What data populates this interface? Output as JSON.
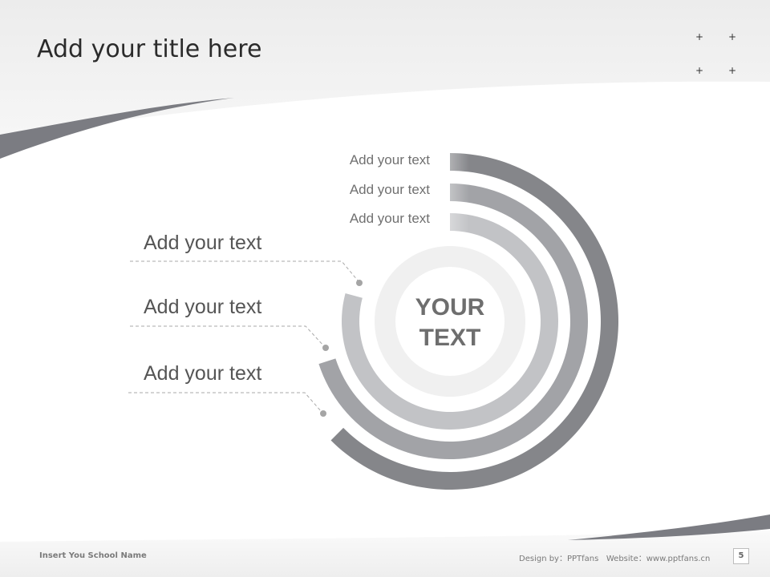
{
  "slide": {
    "title": "Add your title here",
    "decor_marks": [
      "+",
      "+",
      "+",
      "+"
    ],
    "colors": {
      "accent_dark": "#7c7d82",
      "ring_outer": "#85868a",
      "ring_middle": "#a2a3a7",
      "ring_inner": "#c2c3c6",
      "inner_circle": "#f0f0f0",
      "background_band": "#f1f1f1"
    }
  },
  "diagram": {
    "center_text": [
      "YOUR",
      "TEXT"
    ],
    "ring_labels": [
      "Add your text",
      "Add your text",
      "Add your text"
    ],
    "callouts": [
      "Add your text",
      "Add your text",
      "Add your text"
    ]
  },
  "footer": {
    "school_name": "Insert You School Name",
    "credits": "Design by：PPTfans   Website：www.pptfans.cn",
    "page_number": "5"
  }
}
